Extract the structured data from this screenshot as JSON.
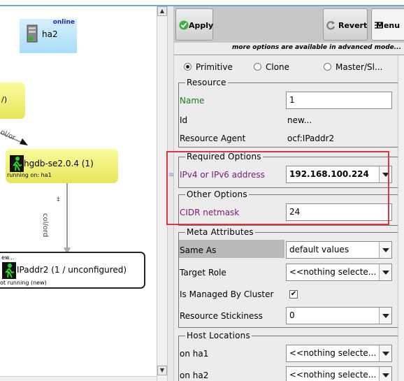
{
  "graph": {
    "host": {
      "status": "online",
      "name": "ha2"
    },
    "box1_text": "/)",
    "edge_label_1": "ol/or",
    "node1": {
      "title": "hgdb-se2.0.4 (1)",
      "sub": "running on: ha1"
    },
    "edge_label_2": "col/ord",
    "node2": {
      "top_text": "ew...",
      "title": "IPaddr2 (1 / unconfigured)",
      "sub": "ot running (new)"
    }
  },
  "toolbar": {
    "apply_label": "Apply",
    "revert_label": "Revert",
    "menu_label": "Menu"
  },
  "advanced_note": "more options are available in advanced mode...",
  "radios": [
    {
      "label": "Primitive",
      "selected": true
    },
    {
      "label": "Clone",
      "selected": false
    },
    {
      "label": "Master/Sl...",
      "selected": false
    }
  ],
  "resource": {
    "legend": "Resource",
    "name_label": "Name",
    "name_value": "1",
    "id_label": "Id",
    "id_value": "new...",
    "agent_label": "Resource Agent",
    "agent_value": "ocf:IPaddr2"
  },
  "required": {
    "legend": "Required Options",
    "ip_label": "IPv4 or IPv6 address",
    "ip_value": "192.168.100.224"
  },
  "other": {
    "legend": "Other Options",
    "cidr_label": "CIDR netmask",
    "cidr_value": "24"
  },
  "meta": {
    "legend": "Meta Attributes",
    "same_as_label": "Same As",
    "same_as_value": "default values",
    "target_role_label": "Target Role",
    "target_role_value": "<<nothing selecte...",
    "managed_label": "Is Managed By Cluster",
    "managed_checked": true,
    "stickiness_label": "Resource Stickiness",
    "stickiness_value": "0"
  },
  "locations": {
    "legend": "Host Locations",
    "ha1_label": "on ha1",
    "ha1_value": "<<nothing selecte...",
    "ha2_label": "on ha2",
    "ha2_value": "<<nothing selecte..."
  },
  "colors": {
    "highlight_box": "#e0353a",
    "node_running": "#e6e65a",
    "host_box": "#a9dcf8",
    "green_label": "#1d7a1d",
    "purple_label": "#7b1a7b"
  }
}
